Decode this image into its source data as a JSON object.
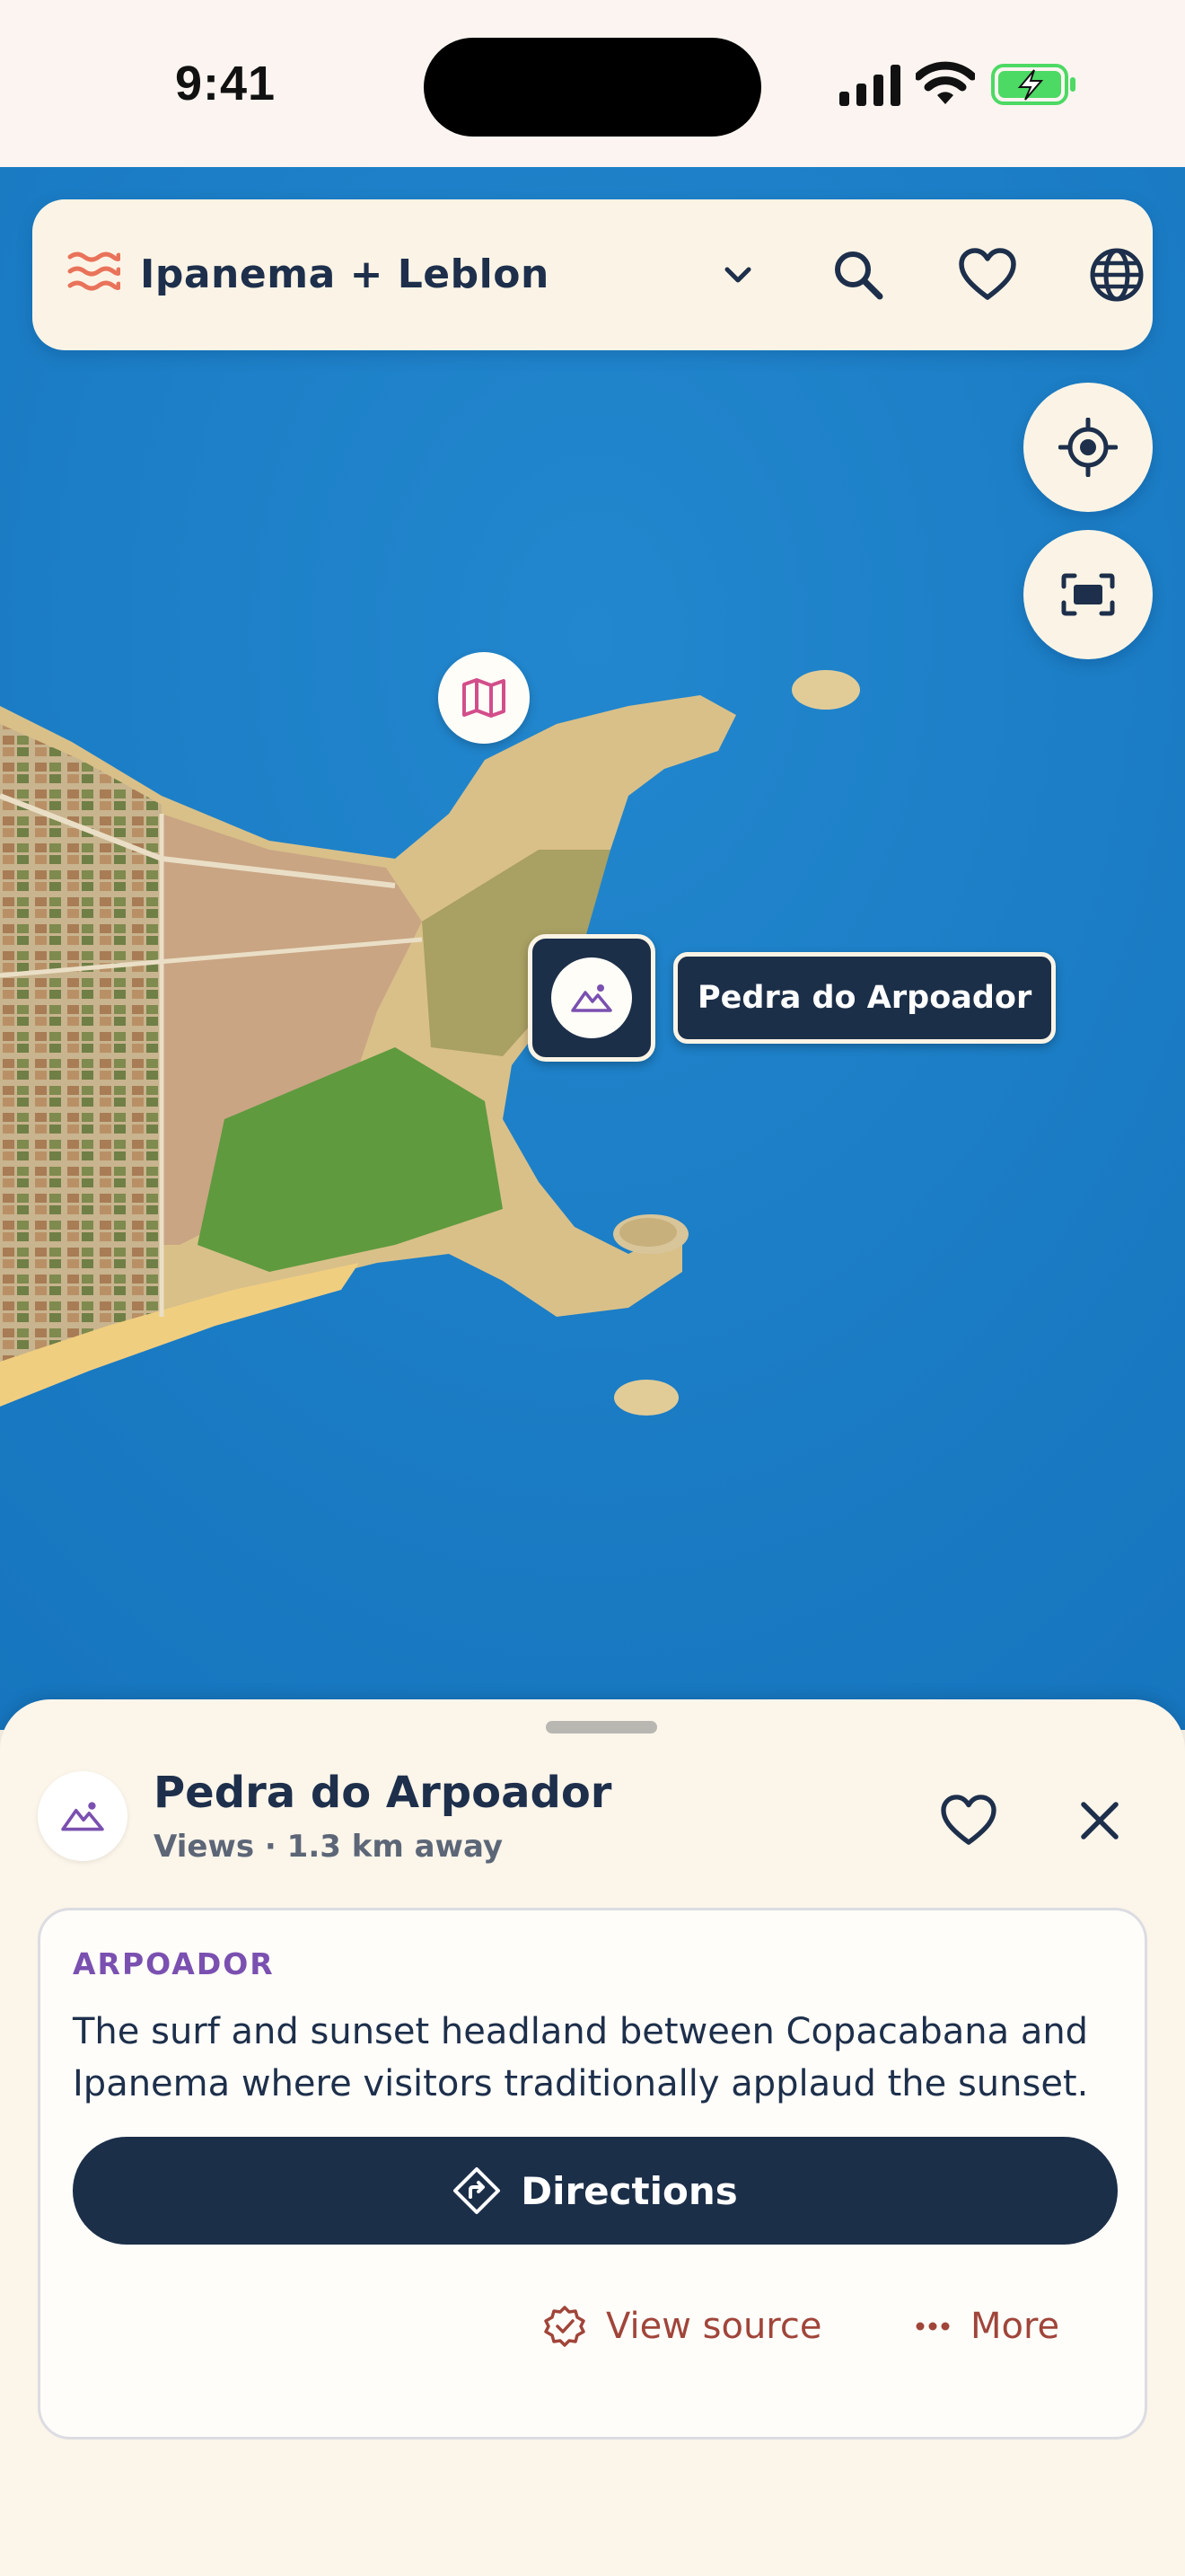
{
  "status_bar": {
    "time": "9:41"
  },
  "header": {
    "title": "Ipanema + Leblon"
  },
  "map": {
    "selected_label": "Pedra do Arpoador"
  },
  "sheet": {
    "title": "Pedra do Arpoador",
    "subtitle": "Views · 1.3 km away",
    "card": {
      "eyebrow": "ARPOADOR",
      "description": "The surf and sunset headland between Copacabana and Ipanema where visitors traditionally applaud the sunset.",
      "directions_label": "Directions",
      "view_source_label": "View source",
      "more_label": "More"
    }
  },
  "colors": {
    "navy": "#1C2F49",
    "ocean": "#1D7FC6",
    "accent_purple": "#7A50B0",
    "link_red": "#A0453A",
    "brand_coral": "#E9735A",
    "battery_green": "#4CD964"
  }
}
